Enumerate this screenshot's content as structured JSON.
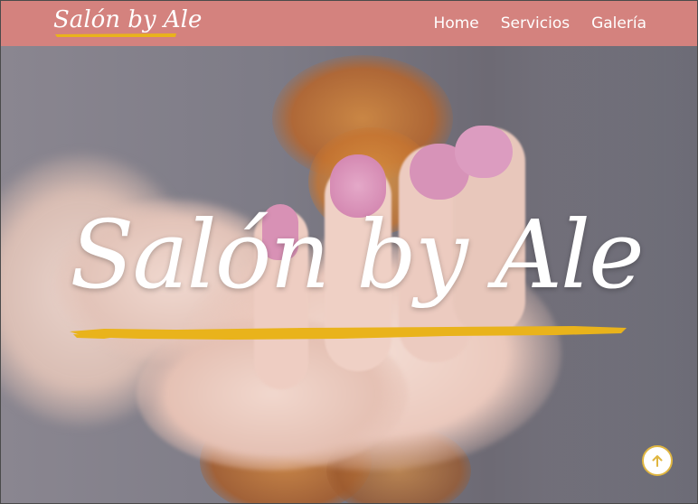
{
  "brand": {
    "name": "Salón by Ale"
  },
  "nav": {
    "items": [
      "Home",
      "Servicios",
      "Galería"
    ]
  },
  "hero": {
    "title": "Salón by Ale"
  },
  "colors": {
    "header": "#d4827e",
    "accent_gold": "#e9b31b",
    "text": "#ffffff",
    "nail_pink": "#d98fb4"
  },
  "icons": {
    "back_to_top": "arrow-up-icon"
  }
}
